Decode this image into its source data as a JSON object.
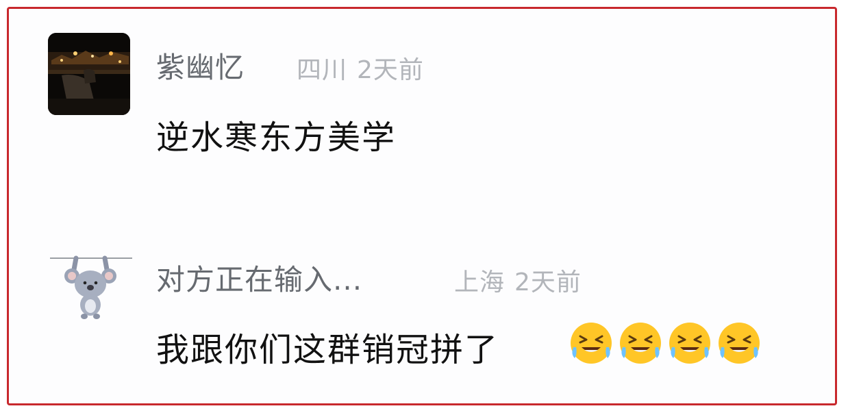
{
  "comments": [
    {
      "username": "紫幽忆",
      "location": "四川",
      "time": "2天前",
      "text": "逆水寒东方美学",
      "avatar": "night-street-photo-avatar"
    },
    {
      "username": "对方正在输入...",
      "location": "上海",
      "time": "2天前",
      "text": "我跟你们这群销冠拼了",
      "avatar": "koala-hanging-avatar",
      "emojis": [
        "laugh-cry-emoji",
        "laugh-cry-emoji",
        "laugh-cry-emoji",
        "laugh-cry-emoji"
      ]
    }
  ],
  "colors": {
    "frame_border": "#c8282d",
    "username": "#666a70",
    "meta": "#b2b5ba",
    "text": "#111111",
    "emoji_face": "#ffc627"
  }
}
